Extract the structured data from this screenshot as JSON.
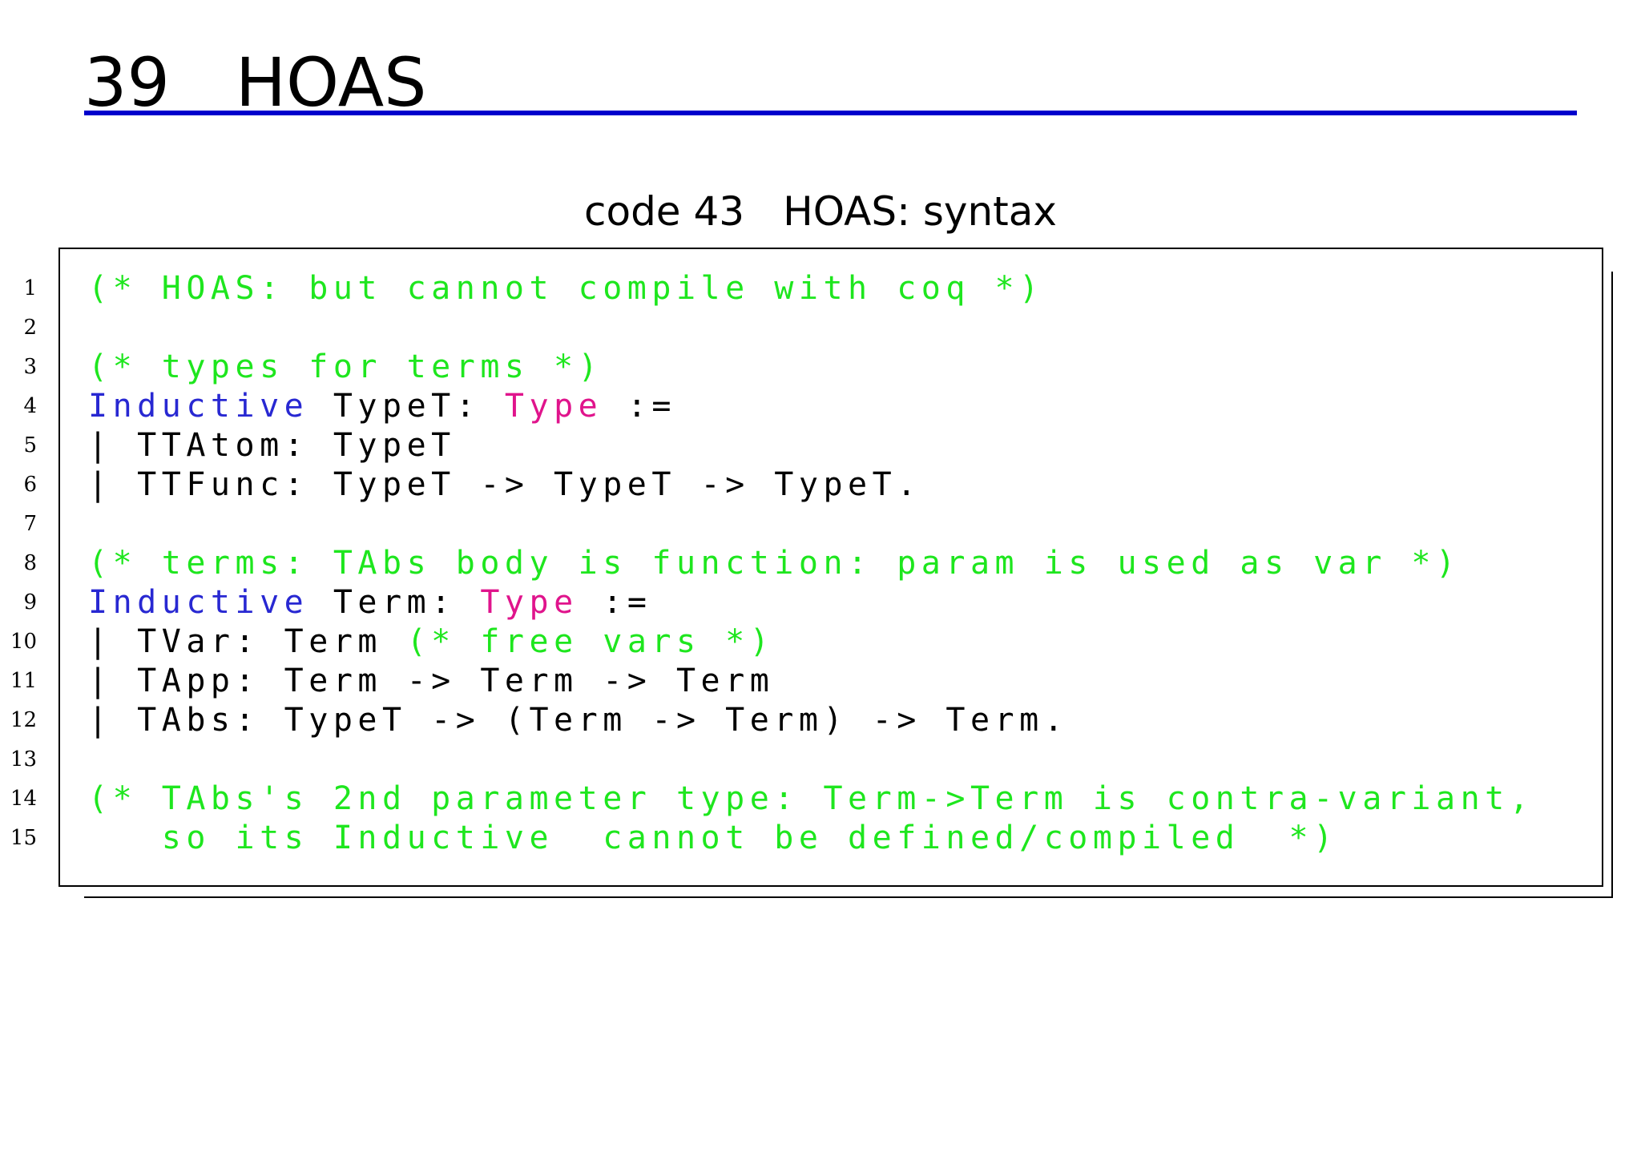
{
  "heading": {
    "number": "39",
    "title": "HOAS"
  },
  "colors": {
    "heading_rule": "#0000cc",
    "comment": "#1ee61e",
    "keyword": "#2828d2",
    "type_keyword": "#e0148c",
    "plain": "#000000"
  },
  "caption": {
    "label": "code 43",
    "text": "HOAS: syntax"
  },
  "code": {
    "line_numbers": [
      "1",
      "2",
      "3",
      "4",
      "5",
      "6",
      "7",
      "8",
      "9",
      "10",
      "11",
      "12",
      "13",
      "14",
      "15"
    ],
    "lines": [
      [
        {
          "t": "(* HOAS: but cannot compile with coq *)",
          "k": "comment"
        }
      ],
      [],
      [
        {
          "t": "(* types for terms *)",
          "k": "comment"
        }
      ],
      [
        {
          "t": "Inductive",
          "k": "keyword"
        },
        {
          "t": " TypeT: ",
          "k": "plain"
        },
        {
          "t": "Type",
          "k": "type"
        },
        {
          "t": " :=",
          "k": "plain"
        }
      ],
      [
        {
          "t": "| TTAtom: TypeT",
          "k": "plain"
        }
      ],
      [
        {
          "t": "| TTFunc: TypeT -> TypeT -> TypeT.",
          "k": "plain"
        }
      ],
      [],
      [
        {
          "t": "(* terms: TAbs body is function: param is used as var *)",
          "k": "comment"
        }
      ],
      [
        {
          "t": "Inductive",
          "k": "keyword"
        },
        {
          "t": " Term: ",
          "k": "plain"
        },
        {
          "t": "Type",
          "k": "type"
        },
        {
          "t": " :=",
          "k": "plain"
        }
      ],
      [
        {
          "t": "| TVar: Term ",
          "k": "plain"
        },
        {
          "t": "(* free vars *)",
          "k": "comment"
        }
      ],
      [
        {
          "t": "| TApp: Term -> Term -> Term",
          "k": "plain"
        }
      ],
      [
        {
          "t": "| TAbs: TypeT -> (Term -> Term) -> Term.",
          "k": "plain"
        }
      ],
      [],
      [
        {
          "t": "(* TAbs's 2nd parameter type: Term->Term is contra-variant,",
          "k": "comment"
        }
      ],
      [
        {
          "t": "   so its Inductive  cannot be defined/compiled  *)",
          "k": "comment"
        }
      ]
    ]
  }
}
